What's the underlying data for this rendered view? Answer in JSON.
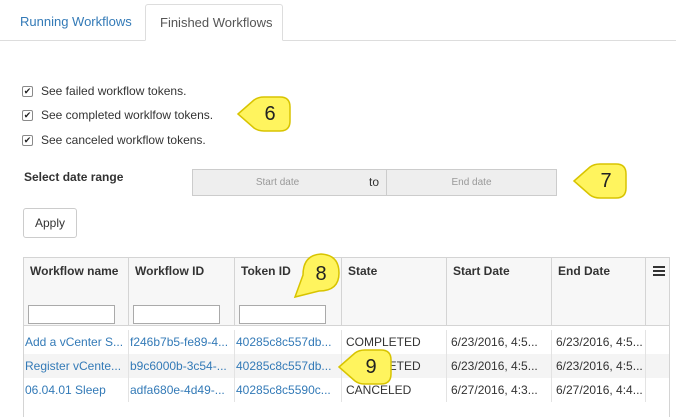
{
  "tabs": {
    "running_label": "Running Workflows",
    "finished_label": "Finished Workflows"
  },
  "filters": {
    "failed_label": "See failed workflow tokens.",
    "completed_label": "See completed worklfow tokens.",
    "canceled_label": "See canceled workflow tokens."
  },
  "callouts": {
    "c6": "6",
    "c7": "7",
    "c8": "8",
    "c9": "9"
  },
  "date_range": {
    "label": "Select date range",
    "start_placeholder": "Start date",
    "separator": "to",
    "end_placeholder": "End date"
  },
  "apply_label": "Apply",
  "table": {
    "columns": [
      "Workflow name",
      "Workflow ID",
      "Token ID",
      "State",
      "Start Date",
      "End Date"
    ],
    "rows": [
      [
        "Add a vCenter S...",
        "f246b7b5-fe89-4...",
        "40285c8c557db...",
        "COMPLETED",
        "6/23/2016, 4:5...",
        "6/23/2016, 4:5..."
      ],
      [
        "Register vCente...",
        "b9c6000b-3c54-...",
        "40285c8c557db...",
        "COMPLETED",
        "6/23/2016, 4:5...",
        "6/23/2016, 4:5..."
      ],
      [
        "06.04.01 Sleep",
        "adfa680e-4d49-...",
        "40285c8c5590c...",
        "CANCELED",
        "6/27/2016, 4:3...",
        "6/27/2016, 4:4..."
      ]
    ]
  },
  "colors": {
    "link": "#337ab7",
    "callout_fill": "#fff45e",
    "callout_stroke": "#d8c400"
  }
}
